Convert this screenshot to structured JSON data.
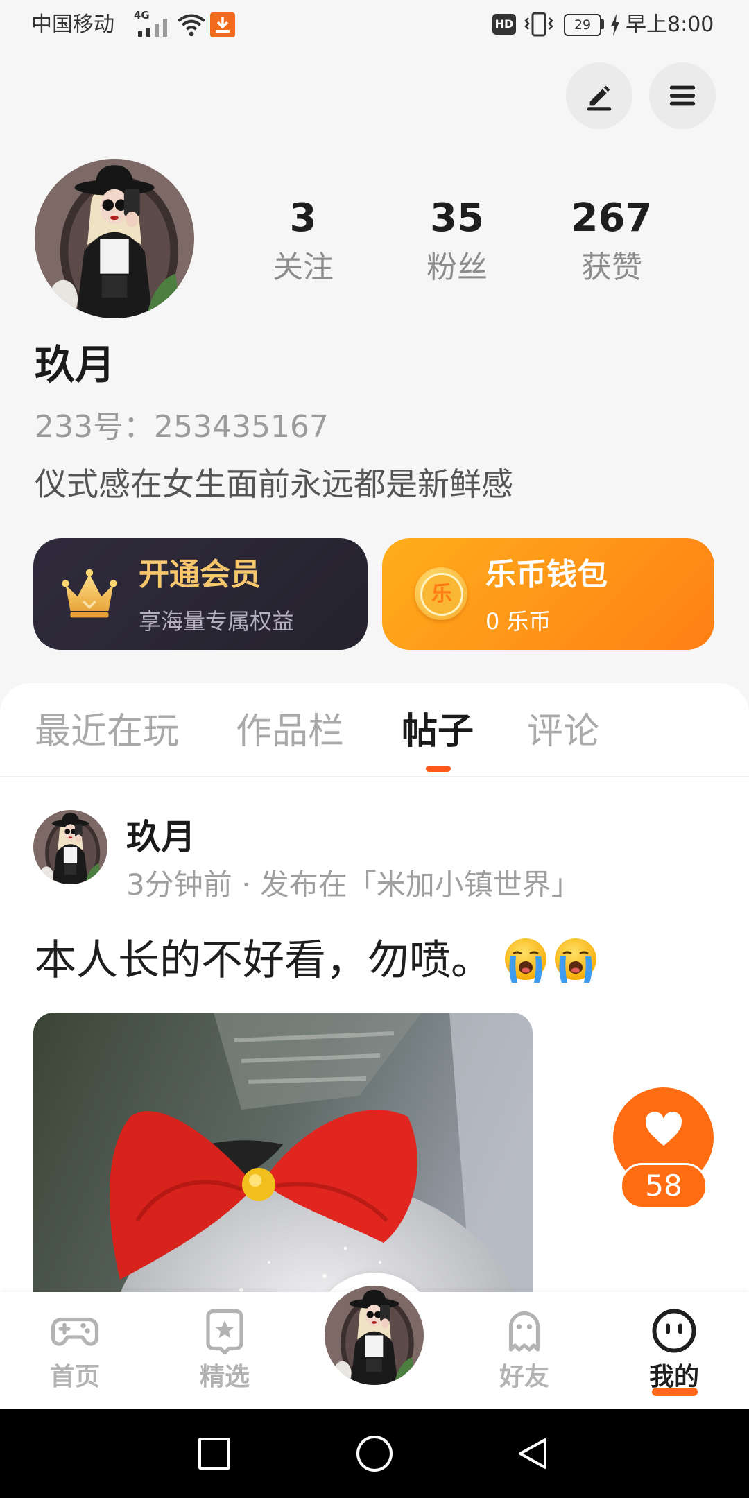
{
  "status_bar": {
    "carrier": "中国移动",
    "network": "4G",
    "hd": "HD",
    "battery": "29",
    "time": "早上8:00",
    "icons": [
      "signal-icon",
      "wifi-icon",
      "download-icon",
      "vibrate-icon",
      "battery-icon",
      "charging-icon"
    ]
  },
  "header": {
    "icons": [
      "edit-icon",
      "menu-icon"
    ]
  },
  "profile": {
    "name": "玖月",
    "id_line": "233号：253435167",
    "bio": "仪式感在女生面前永远都是新鲜感",
    "stats": [
      {
        "value": "3",
        "label": "关注"
      },
      {
        "value": "35",
        "label": "粉丝"
      },
      {
        "value": "267",
        "label": "获赞"
      }
    ]
  },
  "cards": {
    "vip": {
      "title": "开通会员",
      "subtitle": "享海量专属权益",
      "icon": "crown-icon"
    },
    "wallet": {
      "title": "乐币钱包",
      "subtitle": "0 乐币",
      "icon": "coin-icon",
      "coin_glyph": "乐"
    }
  },
  "tabs": [
    {
      "label": "最近在玩",
      "active": false
    },
    {
      "label": "作品栏",
      "active": false
    },
    {
      "label": "帖子",
      "active": true
    },
    {
      "label": "评论",
      "active": false
    }
  ],
  "post": {
    "author": "玖月",
    "meta": "3分钟前 · 发布在「米加小镇世界」",
    "text": "本人长的不好看，勿喷。",
    "emojis": [
      "loudly-crying-face-icon",
      "loudly-crying-face-icon"
    ],
    "likes": "58",
    "like_icon": "heart-icon"
  },
  "bottom_nav": [
    {
      "label": "首页",
      "icon": "gamepad-icon",
      "active": false
    },
    {
      "label": "精选",
      "icon": "star-card-icon",
      "active": false
    },
    {
      "label": "",
      "icon": "avatar",
      "active": false
    },
    {
      "label": "好友",
      "icon": "ghost-icon",
      "active": false
    },
    {
      "label": "我的",
      "icon": "smiley-icon",
      "active": true
    }
  ],
  "system_nav": {
    "icons": [
      "recents-square-icon",
      "home-circle-icon",
      "back-triangle-icon"
    ]
  },
  "colors": {
    "accent": "#ff6c12",
    "vip_card": "#2a2737",
    "vip_gold": "#f7c76e",
    "wallet_start": "#ffae1c",
    "wallet_end": "#ff7f14",
    "tab_indicator": "#ff5a1e"
  }
}
